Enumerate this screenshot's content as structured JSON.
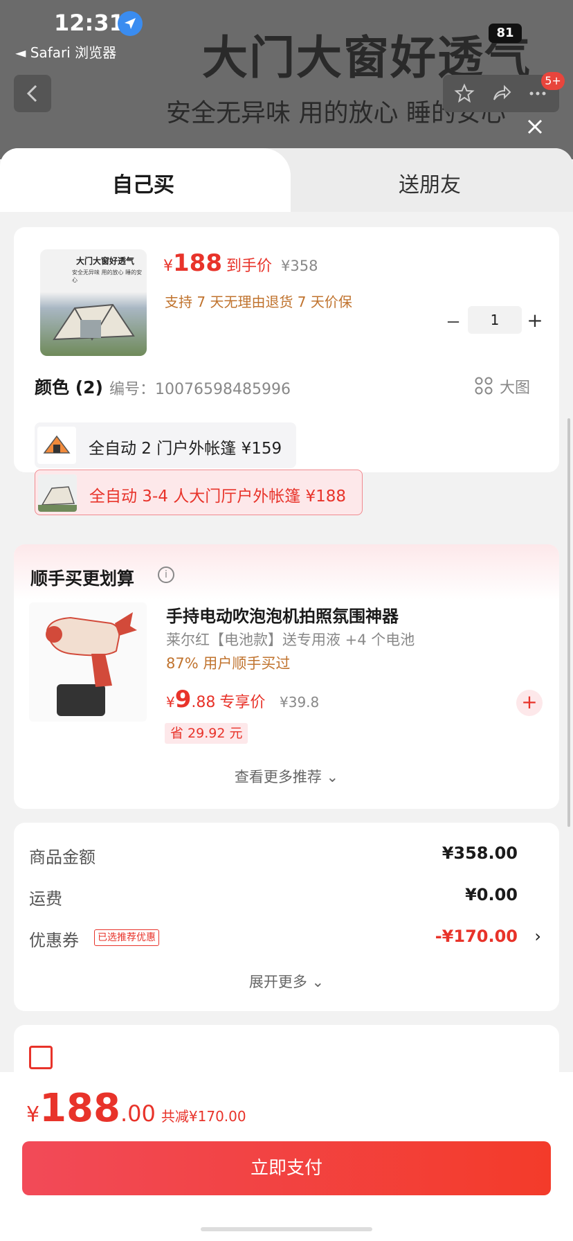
{
  "status": {
    "time": "12:31",
    "back_app": "◄ Safari 浏览器",
    "battery": "81",
    "notification_badge": "5+"
  },
  "background": {
    "headline": "大门大窗好透气",
    "subline": "安全无异味 用的放心 睡的安心"
  },
  "tabs": [
    {
      "label": "自己买",
      "active": true
    },
    {
      "label": "送朋友",
      "active": false
    }
  ],
  "product": {
    "thumb_title": "大门大窗好透气",
    "thumb_sub": "安全无异味 用的放心 睡的安心",
    "price_symbol": "¥",
    "price": "188",
    "price_tag": "到手价",
    "original_price": "¥358",
    "services": "支持 7 天无理由退货   7 天价保",
    "quantity": "1",
    "minus": "−",
    "plus": "+"
  },
  "color": {
    "title": "颜色 (2)",
    "sku": "编号：10076598485996",
    "big_picture_label": "大图",
    "options": [
      {
        "label": "全自动 2 门户外帐篷   ¥159",
        "selected": false
      },
      {
        "label": "全自动 3-4 人大门厅户外帐篷   ¥188",
        "selected": true
      }
    ]
  },
  "addon": {
    "title": "顺手买更划算",
    "info": "i",
    "name": "手持电动吹泡泡机拍照氛围神器",
    "spec": "莱尔红【电池款】送专用液 +4 个电池",
    "rate": "87% 用户顺手买过",
    "price_symbol": "¥",
    "price_int": "9",
    "price_dec": ".88",
    "price_tag": "专享价",
    "original_price": "¥39.8",
    "save": "省 29.92 元",
    "add": "+",
    "more": "查看更多推荐 ⌄"
  },
  "summary": {
    "goods_label": "商品金额",
    "goods_value": "¥358.00",
    "shipping_label": "运费",
    "shipping_value": "¥0.00",
    "coupon_label": "优惠券",
    "coupon_tag": "已选推荐优惠",
    "coupon_value": "-¥170.00",
    "chevron": "›",
    "expand": "展开更多 ⌄"
  },
  "footer": {
    "price_symbol": "¥",
    "total_int": "188",
    "total_dec": ".00",
    "saved": "共减¥170.00",
    "pay_button": "立即支付"
  },
  "colors": {
    "accent": "#e8332a",
    "service": "#c0732e",
    "pay_start": "#f24a58",
    "pay_end": "#f33b2a"
  }
}
